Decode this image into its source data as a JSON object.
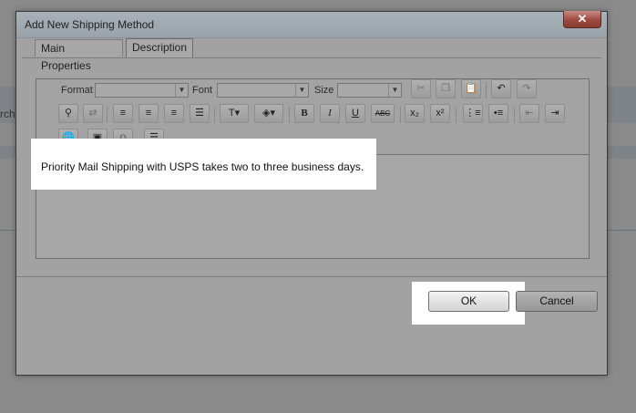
{
  "background": {
    "partial_text": "rch"
  },
  "dialog": {
    "title": "Add New Shipping Method",
    "close_symbol": "✕"
  },
  "tabs": [
    {
      "label": "Main Properties",
      "active": false
    },
    {
      "label": "Description",
      "active": true
    }
  ],
  "toolbar": {
    "format_label": "Format",
    "font_label": "Font",
    "size_label": "Size",
    "format_value": "",
    "font_value": "",
    "size_value": "",
    "bold": "B",
    "italic": "I",
    "underline": "U",
    "strike": "ABC",
    "subscript": "x₂",
    "superscript": "x²"
  },
  "editor": {
    "content": "Priority Mail Shipping with USPS takes two to three business days."
  },
  "buttons": {
    "ok": "OK",
    "cancel": "Cancel"
  }
}
